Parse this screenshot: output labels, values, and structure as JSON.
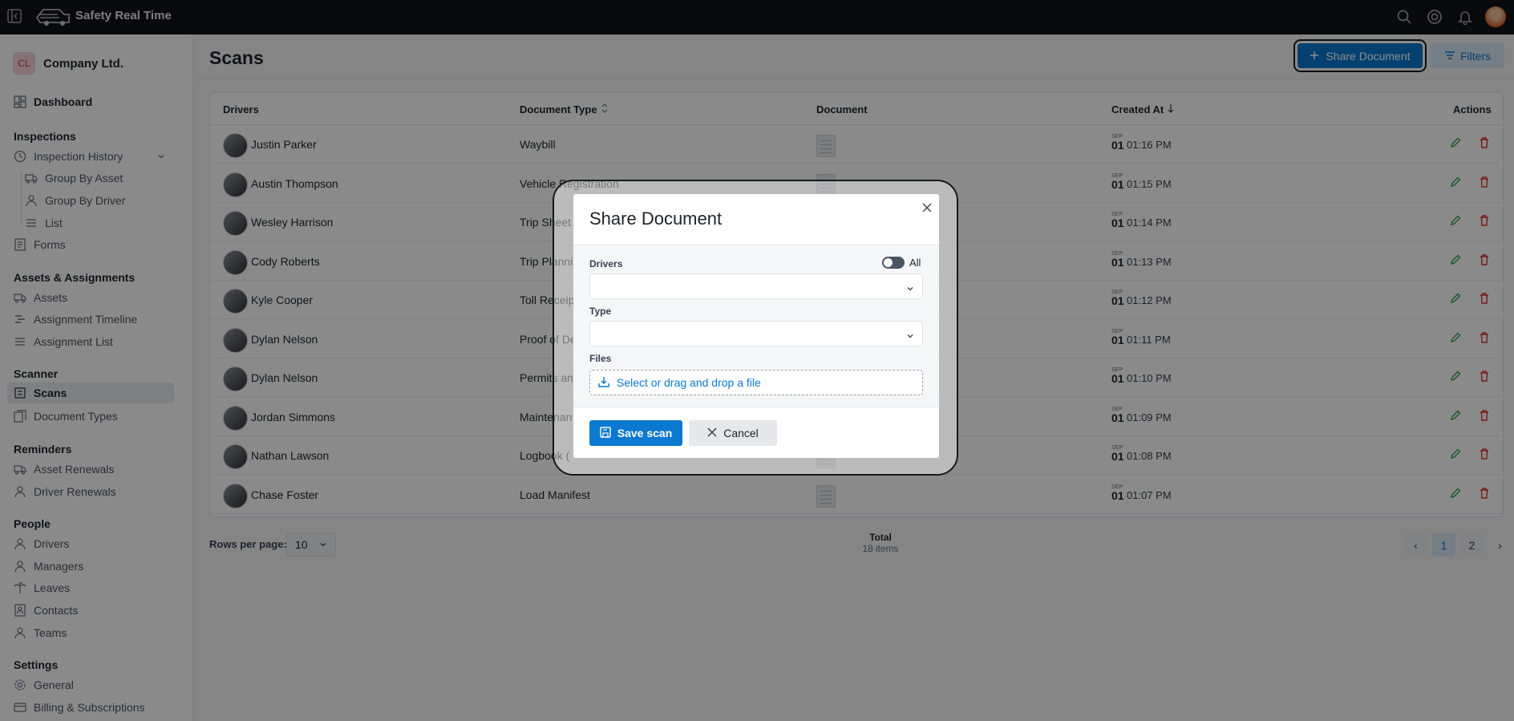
{
  "topbar": {
    "brand": "Safety Real Time"
  },
  "sidebar": {
    "company": {
      "initials": "CL",
      "name": "Company Ltd."
    },
    "dashboard": "Dashboard",
    "sections": {
      "inspections": "Inspections",
      "assets": "Assets & Assignments",
      "scanner": "Scanner",
      "reminders": "Reminders",
      "people": "People",
      "settings": "Settings"
    },
    "items": {
      "inspection_history": "Inspection History",
      "group_by_asset": "Group By Asset",
      "group_by_driver": "Group By Driver",
      "list": "List",
      "forms": "Forms",
      "assets": "Assets",
      "assignment_timeline": "Assignment Timeline",
      "assignment_list": "Assignment List",
      "scans": "Scans",
      "document_types": "Document Types",
      "asset_renewals": "Asset Renewals",
      "driver_renewals": "Driver Renewals",
      "drivers": "Drivers",
      "managers": "Managers",
      "leaves": "Leaves",
      "contacts": "Contacts",
      "teams": "Teams",
      "general": "General",
      "billing": "Billing & Subscriptions"
    }
  },
  "page": {
    "title": "Scans",
    "share_label": "Share Document",
    "filters_label": "Filters"
  },
  "table": {
    "headers": {
      "drivers": "Drivers",
      "document_type": "Document Type",
      "document": "Document",
      "created_at": "Created At",
      "actions": "Actions"
    },
    "rows": [
      {
        "driver": "Justin Parker",
        "type": "Waybill",
        "month": "SEP",
        "day": "01",
        "time": "01:16 PM"
      },
      {
        "driver": "Austin Thompson",
        "type": "Vehicle Registration",
        "month": "SEP",
        "day": "01",
        "time": "01:15 PM"
      },
      {
        "driver": "Wesley Harrison",
        "type": "Trip Sheet",
        "month": "SEP",
        "day": "01",
        "time": "01:14 PM"
      },
      {
        "driver": "Cody Roberts",
        "type": "Trip Planni",
        "month": "SEP",
        "day": "01",
        "time": "01:13 PM"
      },
      {
        "driver": "Kyle Cooper",
        "type": "Toll Receip",
        "month": "SEP",
        "day": "01",
        "time": "01:12 PM"
      },
      {
        "driver": "Dylan Nelson",
        "type": "Proof of De",
        "month": "SEP",
        "day": "01",
        "time": "01:11 PM"
      },
      {
        "driver": "Dylan Nelson",
        "type": "Permits an",
        "month": "SEP",
        "day": "01",
        "time": "01:10 PM"
      },
      {
        "driver": "Jordan Simmons",
        "type": "Maintenan",
        "month": "SEP",
        "day": "01",
        "time": "01:09 PM"
      },
      {
        "driver": "Nathan Lawson",
        "type": "Logbook (",
        "month": "SEP",
        "day": "01",
        "time": "01:08 PM"
      },
      {
        "driver": "Chase Foster",
        "type": "Load Manifest",
        "month": "SEP",
        "day": "01",
        "time": "01:07 PM"
      }
    ]
  },
  "footer": {
    "rows_per_page_label": "Rows per page:",
    "rows_per_page_value": "10",
    "total_label": "Total",
    "total_value": "18 items",
    "pages": [
      "1",
      "2"
    ],
    "prev": "‹",
    "next": "›"
  },
  "modal": {
    "title": "Share Document",
    "drivers_label": "Drivers",
    "all_label": "All",
    "type_label": "Type",
    "files_label": "Files",
    "dropzone_text": "Select or drag and drop a file",
    "save_label": "Save scan",
    "cancel_label": "Cancel"
  },
  "colors": {
    "primary": "#0b79d0",
    "danger": "#e03131",
    "sidebar_bg": "#ffffff",
    "topbar_bg": "#111318"
  }
}
